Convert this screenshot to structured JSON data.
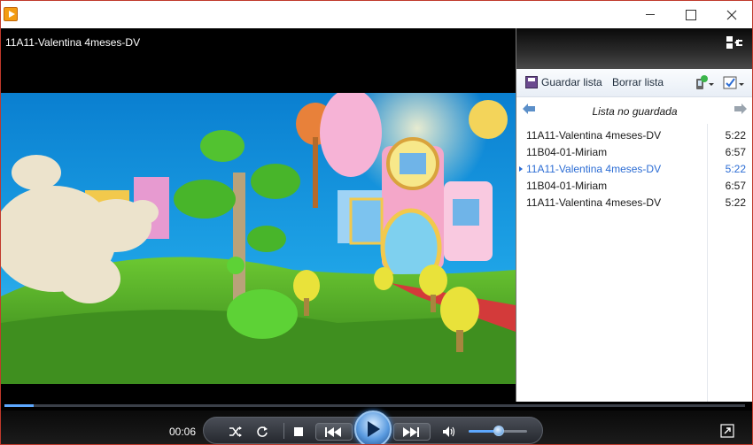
{
  "window": {
    "icon": "media-player-app-icon",
    "minimize_icon": "minimize-icon",
    "maximize_icon": "maximize-icon",
    "close_icon": "close-icon"
  },
  "video": {
    "title": "11A11-Valentina 4meses-DV"
  },
  "playlist_pane": {
    "layout_icon": "switch-layout-icon",
    "toolbar": {
      "save_label": "Guardar lista",
      "clear_label": "Borrar lista",
      "sync_icon": "device-sync-icon",
      "options_icon": "list-options-icon"
    },
    "name": "Lista no guardada",
    "items": [
      {
        "title": "11A11-Valentina 4meses-DV",
        "duration": "5:22",
        "playing": false
      },
      {
        "title": "11B04-01-Miriam",
        "duration": "6:57",
        "playing": false
      },
      {
        "title": "11A11-Valentina 4meses-DV",
        "duration": "5:22",
        "playing": true
      },
      {
        "title": "11B04-01-Miriam",
        "duration": "6:57",
        "playing": false
      },
      {
        "title": "11A11-Valentina 4meses-DV",
        "duration": "5:22",
        "playing": false
      }
    ]
  },
  "playback": {
    "elapsed": "00:06",
    "progress_fraction": 0.04,
    "volume_fraction": 0.5
  },
  "colors": {
    "accent": "#5da8ff",
    "active_item": "#2b6cd4",
    "window_border": "#c0392b"
  }
}
